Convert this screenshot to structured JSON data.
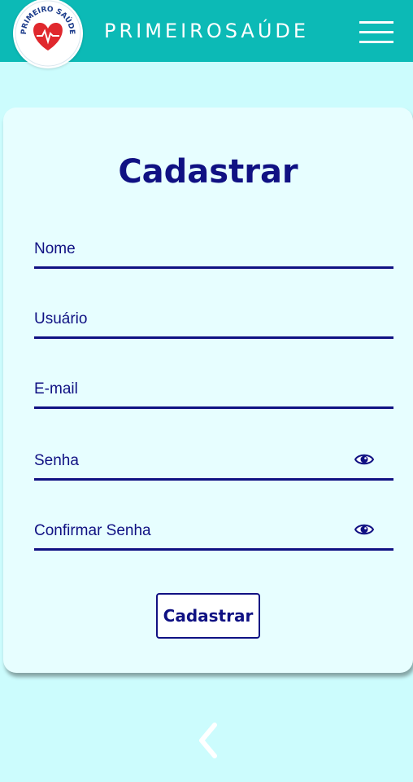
{
  "header": {
    "brand": "PRIMEIROSAÚDE",
    "logo_text": "PRIMEIRO SAÚDE",
    "logo_icon": "heart-pulse-icon",
    "menu_icon": "hamburger-menu-icon",
    "color": "#0cbab6"
  },
  "form": {
    "title": "Cadastrar",
    "fields": [
      {
        "placeholder": "Nome",
        "value": ""
      },
      {
        "placeholder": "Usuário",
        "value": ""
      },
      {
        "placeholder": "E-mail",
        "value": ""
      },
      {
        "placeholder": "Senha",
        "value": "",
        "icon": "eye-icon"
      },
      {
        "placeholder": "Confirmar Senha",
        "value": "",
        "icon": "eye-icon"
      }
    ],
    "submit_label": "Cadastrar"
  },
  "nav": {
    "back_icon": "chevron-left-icon"
  },
  "colors": {
    "background": "#ccfcfd",
    "card": "#e7feff",
    "primary": "#101183",
    "heart": "#e0282d"
  }
}
